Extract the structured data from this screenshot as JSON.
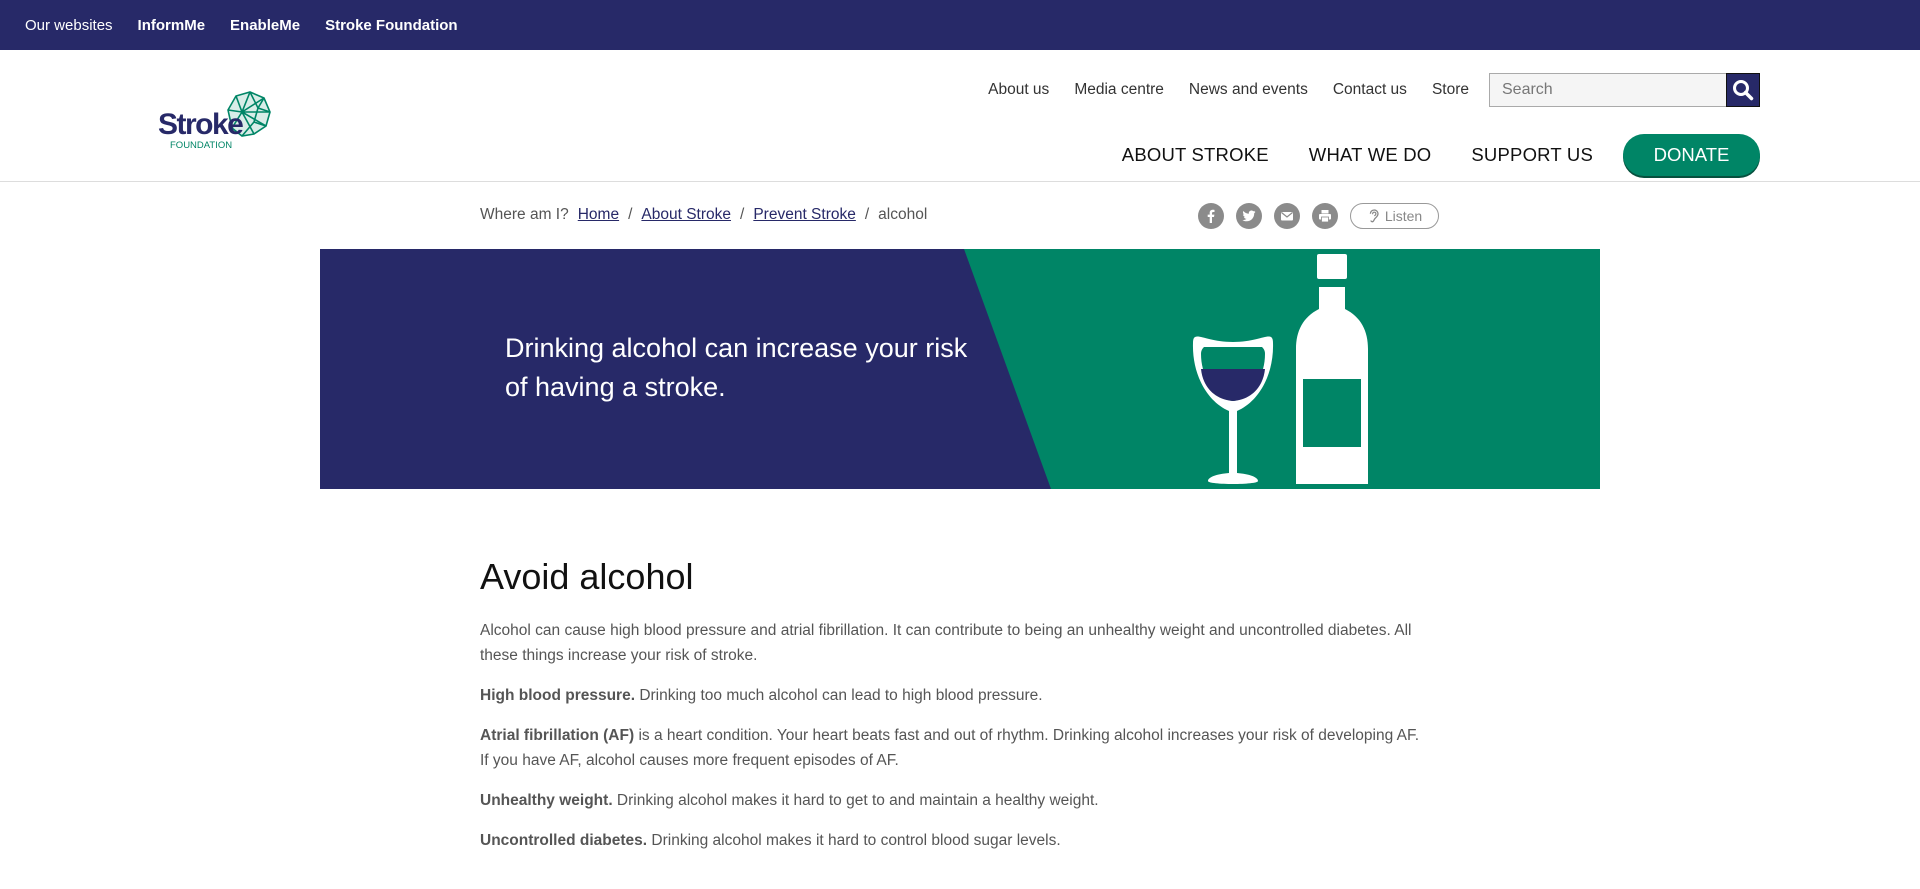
{
  "topbar": {
    "label": "Our websites",
    "sites": [
      "InformMe",
      "EnableMe",
      "Stroke Foundation"
    ]
  },
  "logo": {
    "word": "Stroke",
    "sub": "FOUNDATION"
  },
  "util_nav": [
    "About us",
    "Media centre",
    "News and events",
    "Contact us",
    "Store"
  ],
  "search": {
    "placeholder": "Search",
    "value": ""
  },
  "main_nav": [
    "ABOUT STROKE",
    "WHAT WE DO",
    "SUPPORT US"
  ],
  "donate_label": "DONATE",
  "breadcrumb": {
    "prefix": "Where am I?",
    "links": [
      "Home",
      "About Stroke",
      "Prevent Stroke"
    ],
    "current": "alcohol",
    "sep": "/"
  },
  "share": {
    "icons": [
      "facebook-icon",
      "twitter-icon",
      "email-icon",
      "print-icon"
    ],
    "listen_label": "Listen"
  },
  "hero": {
    "text": "Drinking alcohol can increase your risk of having a stroke."
  },
  "colors": {
    "navy": "#272968",
    "green": "#008566"
  },
  "article": {
    "title": "Avoid alcohol",
    "intro": "Alcohol can cause high blood pressure and atrial fibrillation. It can contribute to being an unhealthy weight and uncontrolled diabetes. All these things increase your risk of stroke.",
    "items": [
      {
        "term": "High blood pressure.",
        "text": " Drinking too much alcohol can lead to high blood pressure."
      },
      {
        "term": "Atrial fibrillation (AF)",
        "text": " is a heart condition. Your heart beats fast and out of rhythm. Drinking alcohol increases your risk of developing AF. If you have AF, alcohol causes more frequent episodes of AF."
      },
      {
        "term": "Unhealthy weight.",
        "text": " Drinking alcohol makes it hard to get to and maintain a healthy weight."
      },
      {
        "term": "Uncontrolled diabetes.",
        "text": " Drinking alcohol makes it hard to control blood sugar levels."
      }
    ]
  }
}
